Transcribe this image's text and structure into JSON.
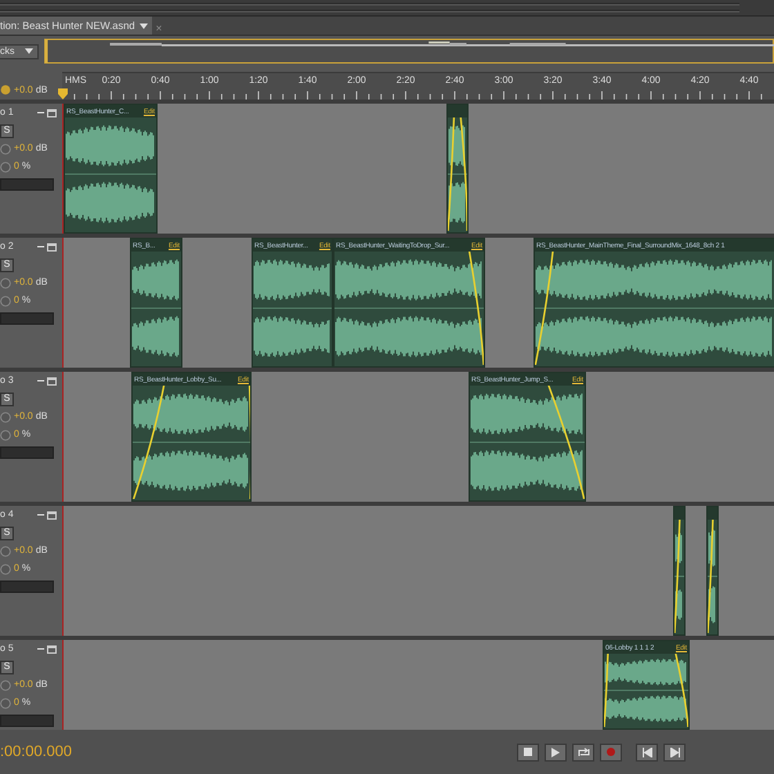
{
  "tab": {
    "title": "tion: Beast Hunter NEW.asnd",
    "close": "×"
  },
  "overview": {
    "dropdown": "cks"
  },
  "ruler": {
    "volume": "+0.0",
    "unit": "dB",
    "label": "HMS",
    "ticks": [
      "0:20",
      "0:40",
      "1:00",
      "1:20",
      "1:40",
      "2:00",
      "2:20",
      "2:40",
      "3:00",
      "3:20",
      "3:40",
      "4:00",
      "4:20",
      "4:40"
    ]
  },
  "tracks": [
    {
      "name": "o 1",
      "solo": "S",
      "volume": "+0.0",
      "volume_unit": "dB",
      "pan": "0",
      "pan_unit": "%",
      "clips": [
        {
          "kind": "full",
          "name": "RS_BeastHunter_C...",
          "edit": "Edit"
        },
        {
          "kind": "short"
        }
      ]
    },
    {
      "name": "o 2",
      "solo": "S",
      "volume": "+0.0",
      "volume_unit": "dB",
      "pan": "0",
      "pan_unit": "%",
      "clips": [
        {
          "kind": "full",
          "name": "RS_B...",
          "edit": "Edit"
        },
        {
          "kind": "full",
          "name": "RS_BeastHunter...",
          "edit": "Edit"
        },
        {
          "kind": "full",
          "name": "RS_BeastHunter_WaitingToDrop_Sur...",
          "edit": "Edit"
        },
        {
          "kind": "full",
          "name": "RS_BeastHunter_MainTheme_Final_SurroundMix_1648_8ch 2 1"
        }
      ]
    },
    {
      "name": "o 3",
      "solo": "S",
      "volume": "+0.0",
      "volume_unit": "dB",
      "pan": "0",
      "pan_unit": "%",
      "clips": [
        {
          "kind": "full",
          "name": "RS_BeastHunter_Lobby_Su...",
          "edit": "Edit"
        },
        {
          "kind": "full",
          "name": "RS_BeastHunter_Jump_S...",
          "edit": "Edit"
        }
      ]
    },
    {
      "name": "o 4",
      "solo": "S",
      "volume": "+0.0",
      "volume_unit": "dB",
      "pan": "0",
      "pan_unit": "%",
      "clips": [
        {
          "kind": "short"
        },
        {
          "kind": "short"
        }
      ]
    },
    {
      "name": "o 5",
      "solo": "S",
      "volume": "+0.0",
      "volume_unit": "dB",
      "pan": "0",
      "pan_unit": "%",
      "clips": [
        {
          "kind": "full",
          "name": "06-Lobby 1 1 1 2",
          "edit": "Edit"
        }
      ]
    }
  ],
  "transport": {
    "time": ":00:00.000"
  }
}
